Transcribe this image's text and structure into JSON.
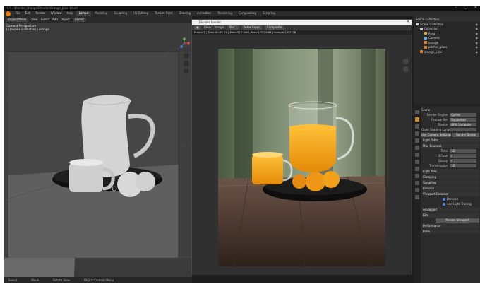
{
  "app": {
    "title": "C:\\...\\Blender_Orange\\Blender\\Orange_Juice.blend",
    "window_controls": [
      "–",
      "□",
      "✕"
    ]
  },
  "menubar": {
    "menus": [
      "File",
      "Edit",
      "Render",
      "Window",
      "Help"
    ],
    "workspaces": [
      "Layout",
      "Modeling",
      "Sculpting",
      "UV Editing",
      "Texture Paint",
      "Shading",
      "Animation",
      "Rendering",
      "Compositing",
      "Scripting"
    ],
    "active_workspace": "Layout",
    "scene": "Scene",
    "view_layer": "View Layer"
  },
  "viewport": {
    "mode": "Object Mode",
    "menus": [
      "View",
      "Select",
      "Add",
      "Object"
    ],
    "transform": "Global",
    "overlay_line1": "Camera Perspective",
    "overlay_line2": "(1) Scene Collection | orange",
    "footer": [
      "Select",
      "Move",
      "Rotate View",
      "Object Context Menu"
    ]
  },
  "render_window": {
    "title": "Blender Render",
    "view_menus": [
      "View",
      "Image"
    ],
    "slot": "Slot 1",
    "layer": "View Layer",
    "pass": "Composite",
    "info": "Frame:1 | Time:00:45.12 | Mem:512.34M, Peak:1024.56M | Sample 128/128"
  },
  "outliner": {
    "header": "Scene Collection",
    "items": [
      {
        "label": "Scene Collection",
        "depth": 0,
        "color": "#cfcfcf"
      },
      {
        "label": "Collection",
        "depth": 1,
        "color": "#cfcfcf"
      },
      {
        "label": "Area",
        "depth": 2,
        "color": "#e8b74a"
      },
      {
        "label": "Camera",
        "depth": 2,
        "color": "#6bb3e0"
      },
      {
        "label": "orange",
        "depth": 2,
        "color": "#f08a24"
      },
      {
        "label": "pitcher_glass",
        "depth": 2,
        "color": "#f08a24"
      },
      {
        "label": "orange_juice",
        "depth": 1,
        "color": "#f08a24"
      }
    ]
  },
  "properties": {
    "header": "Scene",
    "rows": [
      {
        "label": "Render Engine",
        "value": "Cycles"
      },
      {
        "label": "Feature Set",
        "value": "Supported"
      },
      {
        "label": "Device",
        "value": "GPU Compute"
      },
      {
        "label": "Open Shading Language",
        "value": ""
      }
    ],
    "buttons": [
      "Use Camera Settings",
      "Render Scene"
    ],
    "sections": [
      "Light Paths",
      "Max Bounces",
      "Light Tree",
      "Clamping",
      "Sampling",
      "Denoise",
      "Viewport Denoiser",
      "Advanced",
      "Film",
      "Performance",
      "Bake"
    ],
    "bounce_rows": [
      {
        "label": "Total",
        "value": "12"
      },
      {
        "label": "Diffuse",
        "value": "4"
      },
      {
        "label": "Glossy",
        "value": "4"
      },
      {
        "label": "Transmission",
        "value": "12"
      }
    ],
    "checks": [
      "Denoise",
      "Add Light Tracing"
    ],
    "footer_btn": "Render Viewport"
  },
  "colors": {
    "accent": "#e87d0d",
    "panel": "#2b2b2b",
    "orange_juice": "#f5a516"
  }
}
